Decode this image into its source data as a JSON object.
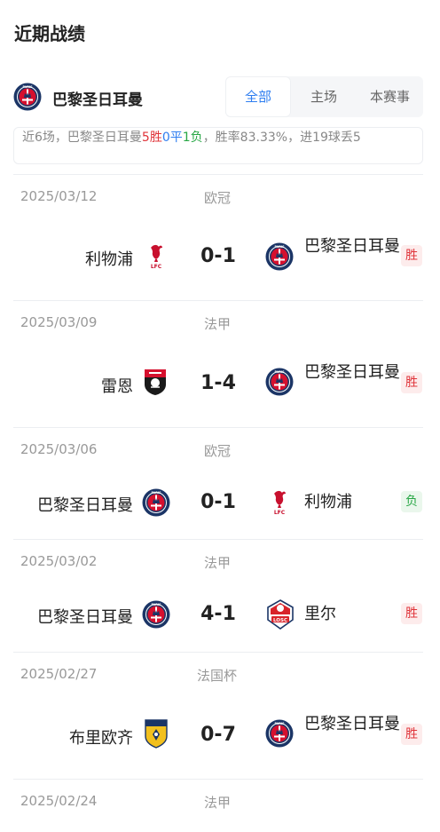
{
  "title": "近期战绩",
  "team": {
    "name": "巴黎圣日耳曼",
    "crest_icon": "psg-crest-icon"
  },
  "tabs": [
    {
      "label": "全部",
      "active": true
    },
    {
      "label": "主场",
      "active": false
    },
    {
      "label": "本赛事",
      "active": false
    }
  ],
  "summary": {
    "prefix": "近6场，巴黎圣日耳曼",
    "wins": "5胜",
    "draws": "0平",
    "losses": "1负",
    "suffix": "，胜率83.33%，进19球丢5"
  },
  "matches": [
    {
      "date": "2025/03/12",
      "competition": "欧冠",
      "home": "利物浦",
      "home_crest": "liverpool-crest-icon",
      "score": "0-1",
      "away": "巴黎圣日耳曼",
      "away_crest": "psg-crest-icon",
      "result": "胜"
    },
    {
      "date": "2025/03/09",
      "competition": "法甲",
      "home": "雷恩",
      "home_crest": "rennes-crest-icon",
      "score": "1-4",
      "away": "巴黎圣日耳曼",
      "away_crest": "psg-crest-icon",
      "result": "胜"
    },
    {
      "date": "2025/03/06",
      "competition": "欧冠",
      "home": "巴黎圣日耳曼",
      "home_crest": "psg-crest-icon",
      "score": "0-1",
      "away": "利物浦",
      "away_crest": "liverpool-crest-icon",
      "result": "负"
    },
    {
      "date": "2025/03/02",
      "competition": "法甲",
      "home": "巴黎圣日耳曼",
      "home_crest": "psg-crest-icon",
      "score": "4-1",
      "away": "里尔",
      "away_crest": "lille-crest-icon",
      "result": "胜"
    },
    {
      "date": "2025/02/27",
      "competition": "法国杯",
      "home": "布里欧齐",
      "home_crest": "briochin-crest-icon",
      "score": "0-7",
      "away": "巴黎圣日耳曼",
      "away_crest": "psg-crest-icon",
      "result": "胜"
    },
    {
      "date": "2025/02/24",
      "competition": "法甲"
    }
  ],
  "colors": {
    "accent": "#2f7ef0",
    "win": "#e0343a",
    "loss": "#28a745",
    "psg_navy": "#1b3566",
    "psg_red": "#d5102e",
    "liverpool_red": "#c8102e",
    "lille_red": "#d8232a"
  }
}
